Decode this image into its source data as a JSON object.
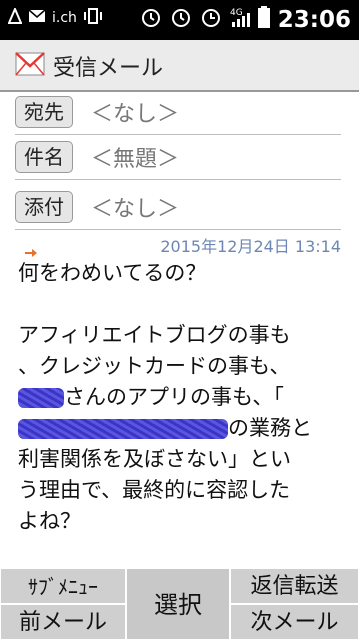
{
  "status": {
    "carrier_label": "i.ch",
    "network": "4G",
    "time": "23:06"
  },
  "app": {
    "title": "受信メール"
  },
  "headers": [
    {
      "label": "宛先",
      "value": "＜なし＞"
    },
    {
      "label": "件名",
      "value": "＜無題＞"
    },
    {
      "label": "添付",
      "value": "＜なし＞"
    }
  ],
  "message": {
    "date": "2015年12月24日 13:14",
    "line1": "何をわめいてるの？",
    "line2": "アフィリエイトブログの事も",
    "line3": "、クレジットカードの事も、",
    "line4_suffix": "さんのアプリの事も、「",
    "line5_suffix": "の業務と",
    "line6": "利害関係を及ぼさない」とい",
    "line7": "う理由で、最終的に容認した",
    "line8": "よね？"
  },
  "softkeys": {
    "sub_menu": "ｻﾌﾞﾒﾆｭｰ",
    "prev_mail": "前メール",
    "select": "選択",
    "reply_forward": "返信転送",
    "next_mail": "次メール"
  },
  "colors": {
    "date": "#6d87b4",
    "softkey_bg": "#cfcfcf",
    "redaction": "#3a35c6"
  }
}
